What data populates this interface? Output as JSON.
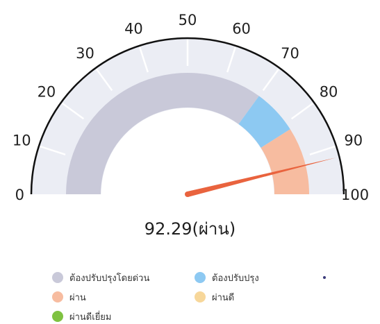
{
  "chart_data": {
    "type": "gauge",
    "min": 0,
    "max": 100,
    "ticks": [
      0,
      10,
      20,
      30,
      40,
      50,
      60,
      70,
      80,
      90,
      100
    ],
    "value": 92.29,
    "value_text": "92.29(ผ่าน)",
    "bands": [
      {
        "from": 0,
        "to": 70,
        "color": "#c9c9d9",
        "legend": "ต้องปรับปรุงโดยด่วน"
      },
      {
        "from": 70,
        "to": 82,
        "color": "#8dc9f2",
        "legend": "ต้องปรับปรุง"
      },
      {
        "from": 82,
        "to": 100,
        "color": "#f7bca0",
        "legend": "ผ่าน"
      }
    ],
    "legend": [
      {
        "label": "ต้องปรับปรุงโดยด่วน",
        "color": "#c9c9d9"
      },
      {
        "label": "ต้องปรับปรุง",
        "color": "#8dc9f2"
      },
      {
        "label": "ผ่าน",
        "color": "#f7bca0"
      },
      {
        "label": "ผ่านดี",
        "color": "#f7d79a"
      },
      {
        "label": "ผ่านดีเยี่ยม",
        "color": "#7fc241"
      }
    ],
    "colors": {
      "outer_arc": "#ebedf4",
      "needle": "#e9633e",
      "border": "#111111",
      "tick_mark": "#ffffff"
    }
  }
}
